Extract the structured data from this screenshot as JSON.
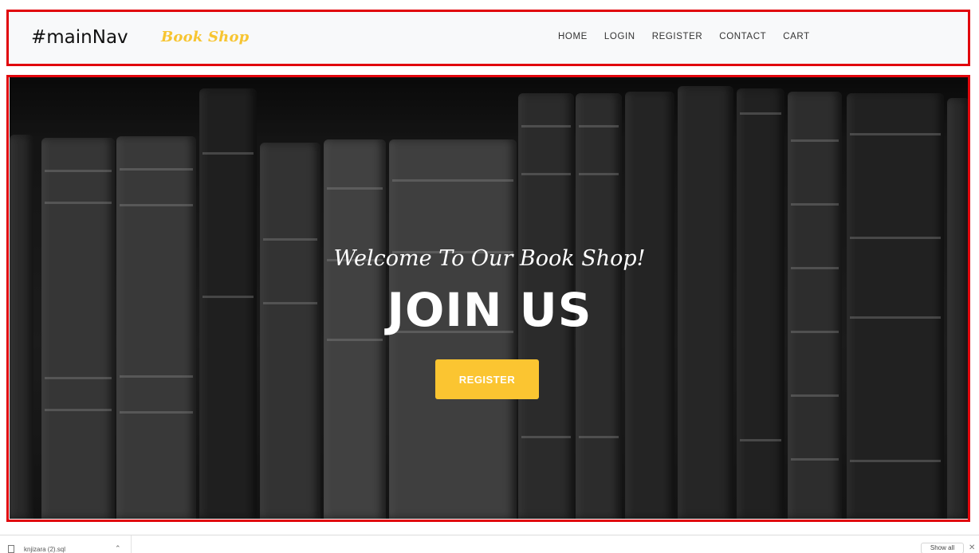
{
  "annotation": {
    "label": "#mainNav"
  },
  "nav": {
    "brand": "Book Shop",
    "items": [
      {
        "label": "HOME"
      },
      {
        "label": "LOGIN"
      },
      {
        "label": "REGISTER"
      },
      {
        "label": "CONTACT"
      },
      {
        "label": "CART"
      }
    ]
  },
  "hero": {
    "welcome": "Welcome To Our Book Shop!",
    "headline": "JOIN US",
    "cta_label": "REGISTER"
  },
  "download_bar": {
    "file_name": "knjizara (2).sql",
    "show_all": "Show all"
  },
  "colors": {
    "accent": "#fbc531",
    "annotation_outline": "#e1050c",
    "nav_background": "#f8f9fa"
  }
}
